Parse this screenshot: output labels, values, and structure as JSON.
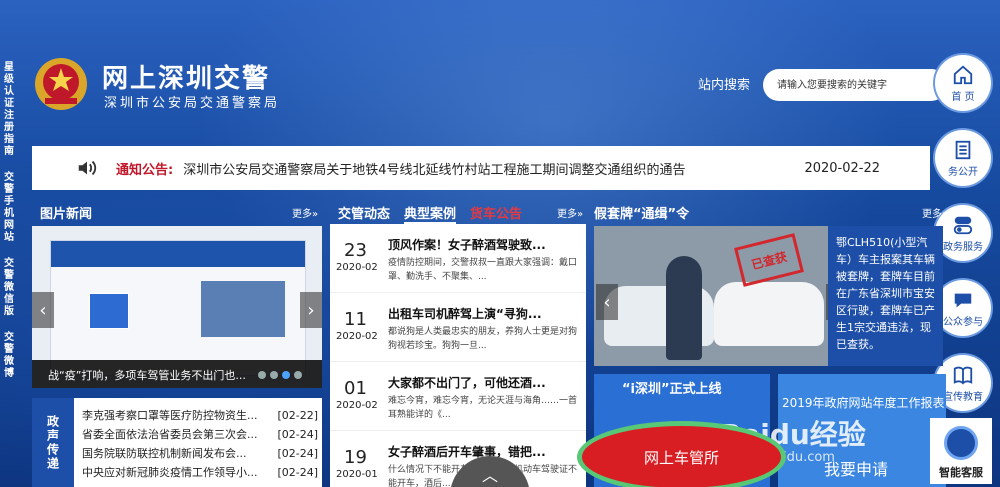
{
  "left_nav": [
    "星级认证注册指南",
    "交警手机网站",
    "交警微信版",
    "交警微博"
  ],
  "header": {
    "title": "网上深圳交警",
    "subtitle": "深圳市公安局交通警察局"
  },
  "search": {
    "label": "站内搜索",
    "placeholder": "请输入您要搜索的关键字"
  },
  "right_nav": [
    {
      "label": "首 页",
      "icon": "home-icon"
    },
    {
      "label": "务公开",
      "icon": "document-icon"
    },
    {
      "label": "政务服务",
      "icon": "toggle-icon"
    },
    {
      "label": "公众参与",
      "icon": "chat-icon"
    },
    {
      "label": "宣传教育",
      "icon": "book-icon"
    }
  ],
  "notice": {
    "label": "通知公告:",
    "text": "深圳市公安局交通警察局关于地铁4号线北延线竹村站工程施工期间调整交通组织的通告",
    "date": "2020-02-22"
  },
  "photo_news": {
    "title": "图片新闻",
    "more": "更多»",
    "caption": "战“疫”打响，多项车驾管业务不出门也..."
  },
  "gov": {
    "label": "政声传递",
    "items": [
      {
        "title": "李克强考察口罩等医疗防控物资生...",
        "date": "[02-22]"
      },
      {
        "title": "省委全面依法治省委员会第三次会...",
        "date": "[02-24]"
      },
      {
        "title": "国务院联防联控机制新闻发布会...",
        "date": "[02-24]"
      },
      {
        "title": "中央应对新冠肺炎疫情工作领导小...",
        "date": "[02-24]"
      }
    ]
  },
  "news_tabs": {
    "tab1": "交管动态",
    "tab2": "典型案例",
    "tab3": "货车公告",
    "more": "更多»"
  },
  "news": [
    {
      "day": "23",
      "ym": "2020-02",
      "title": "顶风作案！女子醉酒驾驶致...",
      "desc": "疫情防控期间，交警叔叔一直跟大家强调：戴口罩、勤洗手、不聚集、..."
    },
    {
      "day": "11",
      "ym": "2020-02",
      "title": "出租车司机醉驾上演“寻狗...",
      "desc": "都说狗是人类最忠实的朋友，养狗人士更是对狗狗视若珍宝。狗狗一旦..."
    },
    {
      "day": "01",
      "ym": "2020-02",
      "title": "大家都不出门了，可他还酒...",
      "desc": "难忘今宵，难忘今宵，无论天涯与海角……一首耳熟能详的《..."
    },
    {
      "day": "19",
      "ym": "2020-01",
      "title": "女子醉酒后开车肇事，错把...",
      "desc": "什么情况下不能开车呢？未取得机动车驾驶证不能开车，酒后..."
    }
  ],
  "fake_plate": {
    "title": "假套牌“通缉”令",
    "more": "更多»",
    "stamp": "已查获",
    "text": "鄂CLH510(小型汽车）车主报案其车辆被套牌，套牌车目前在广东省深圳市宝安区行驶，套牌车已产生1宗交通违法，现已查获。"
  },
  "promo1": {
    "title": "“i深圳”正式上线"
  },
  "promo2": {
    "title": "2019年政府网站年度工作报表"
  },
  "car_office_button": "网上车管所",
  "apply_label": "我要申请",
  "watermark": {
    "brand": "Baidu经验",
    "url": "jingyan.baidu.com"
  },
  "kefu": "智能客服"
}
